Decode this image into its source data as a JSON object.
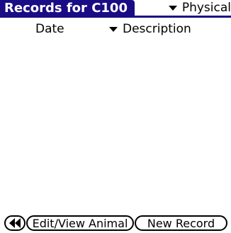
{
  "title": {
    "text": "Records for C100"
  },
  "category": {
    "label": "Physical"
  },
  "columns": {
    "date": "Date",
    "description": "Description"
  },
  "buttons": {
    "edit_view": "Edit/View Animal",
    "new_record": "New Record"
  },
  "icons": {
    "category_dropdown": "triangle-down",
    "description_dropdown": "triangle-down",
    "back": "double-left-arrow"
  },
  "colors": {
    "title_bg": "#1a0c84",
    "title_text": "#ffffff",
    "text": "#000000",
    "background": "#ffffff"
  }
}
